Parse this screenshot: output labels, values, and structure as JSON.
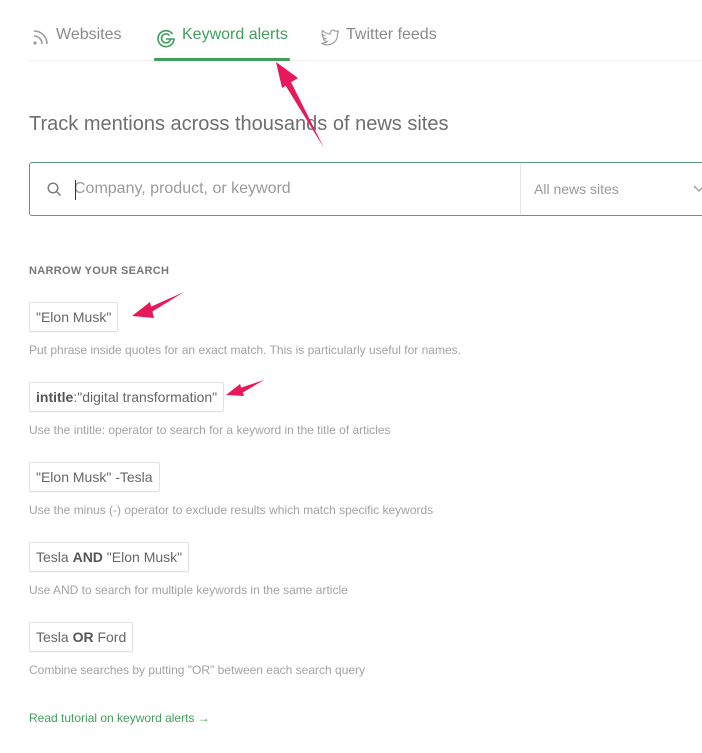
{
  "tabs": [
    {
      "label": "Websites",
      "icon": "rss-icon",
      "active": false
    },
    {
      "label": "Keyword alerts",
      "icon": "google-g-icon",
      "active": true
    },
    {
      "label": "Twitter feeds",
      "icon": "twitter-bird-icon",
      "active": false
    }
  ],
  "headline": "Track mentions across thousands of news sites",
  "search": {
    "placeholder": "Company, product, or keyword",
    "value": "",
    "source_select": "All news sites"
  },
  "narrow": {
    "title": "NARROW YOUR SEARCH",
    "examples": [
      {
        "parts": [
          {
            "text": "\"Elon Musk\"",
            "bold": false
          }
        ],
        "description": "Put phrase inside quotes for an exact match. This is particularly useful for names."
      },
      {
        "parts": [
          {
            "text": "intitle",
            "bold": true
          },
          {
            "text": ":\"digital transformation\"",
            "bold": false
          }
        ],
        "description": "Use the intitle: operator to search for a keyword in the title of articles"
      },
      {
        "parts": [
          {
            "text": "\"Elon Musk\" -Tesla",
            "bold": false
          }
        ],
        "description": "Use the minus (-) operator to exclude results which match specific keywords"
      },
      {
        "parts": [
          {
            "text": "Tesla ",
            "bold": false
          },
          {
            "text": "AND",
            "bold": true
          },
          {
            "text": " \"Elon Musk\"",
            "bold": false
          }
        ],
        "description": "Use AND to search for multiple keywords in the same article"
      },
      {
        "parts": [
          {
            "text": "Tesla ",
            "bold": false
          },
          {
            "text": "OR",
            "bold": true
          },
          {
            "text": " Ford",
            "bold": false
          }
        ],
        "description": "Combine searches by putting \"OR\" between each search query"
      }
    ]
  },
  "tutorial_link": "Read tutorial on keyword alerts →",
  "colors": {
    "accent": "#3f9f5b",
    "annotation_arrow": "#e8195a"
  }
}
